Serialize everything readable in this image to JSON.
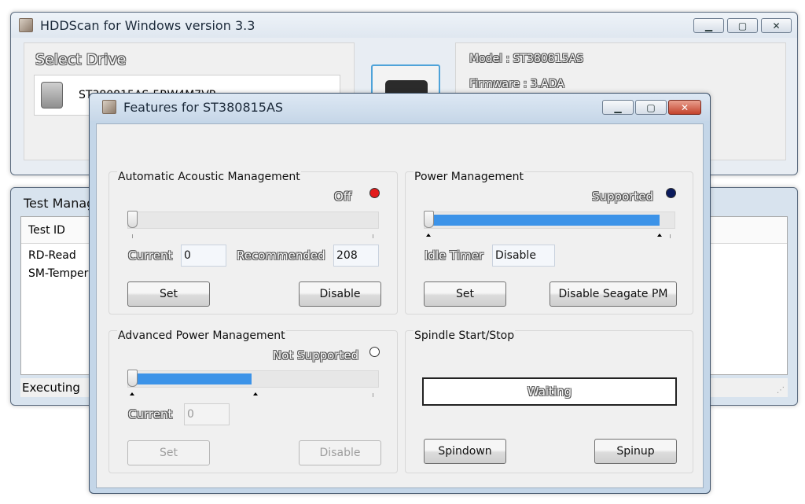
{
  "main_window": {
    "title": "HDDScan for Windows version 3.3",
    "select_drive_label": "Select Drive",
    "drive_name": "ST380815AS-5RW4M7VR",
    "info": {
      "model": "Model : ST380815AS",
      "firmware": "Firmware : 3.ADA"
    },
    "test_manager": {
      "title": "Test Manager",
      "column_test_id": "Test ID",
      "rows": [
        "RD-Read",
        "SM-Temperature"
      ],
      "status": "Executing"
    }
  },
  "features_dialog": {
    "title": "Features for ST380815AS",
    "aam": {
      "title": "Automatic Acoustic Management",
      "state": "Off",
      "state_color": "#e21a1a",
      "level": 0,
      "current_label": "Current",
      "current_value": "0",
      "recommended_label": "Recommended",
      "recommended_value": "208",
      "set_label": "Set",
      "disable_label": "Disable"
    },
    "power": {
      "title": "Power Management",
      "state": "Supported",
      "state_color": "#0a1a5c",
      "level": 0.97,
      "idle_timer_label": "Idle Timer",
      "idle_timer_value": "Disable",
      "set_label": "Set",
      "disable_label": "Disable Seagate PM"
    },
    "apm": {
      "title": "Advanced Power Management",
      "state": "Not Supported",
      "state_color": "#ffffff",
      "level": 0.5,
      "current_label": "Current",
      "current_value": "0",
      "set_label": "Set",
      "disable_label": "Disable"
    },
    "spindle": {
      "title": "Spindle Start/Stop",
      "status": "Waiting",
      "spindown_label": "Spindown",
      "spinup_label": "Spinup"
    }
  },
  "icons": {
    "app_icon": "hddscan-app-icon",
    "drive_icon": "hard-drive-icon",
    "minimize": "minimize-icon",
    "maximize": "maximize-icon",
    "close": "close-icon"
  }
}
